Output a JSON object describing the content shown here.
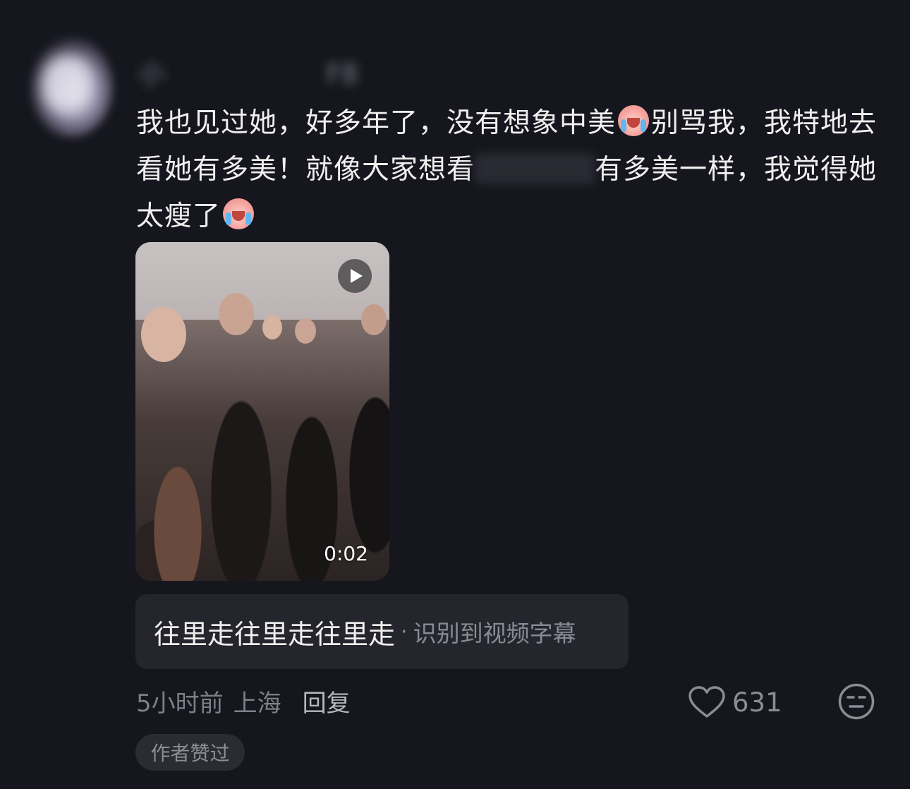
{
  "comment": {
    "username": "小　　　　　　F8",
    "text_parts": {
      "p1": "我也见过她，好多年了，没有想象中美",
      "p2": "别骂我，我特地去看她有多美！就像大家想看",
      "p3": "有多美一样，我觉得她太瘦了"
    },
    "emoji_name": "crying-emoji",
    "video": {
      "duration": "0:02"
    },
    "subtitle": {
      "text": "往里走往里走往里走",
      "separator": "·",
      "note": "识别到视频字幕"
    },
    "meta": {
      "time": "5小时前",
      "location": "上海",
      "reply_label": "回复"
    },
    "like_count": "631",
    "author_liked_label": "作者赞过"
  },
  "colors": {
    "background": "#16161e",
    "text_primary": "#efefef",
    "text_secondary": "#7f7f88",
    "pill_bg": "#25252d"
  }
}
